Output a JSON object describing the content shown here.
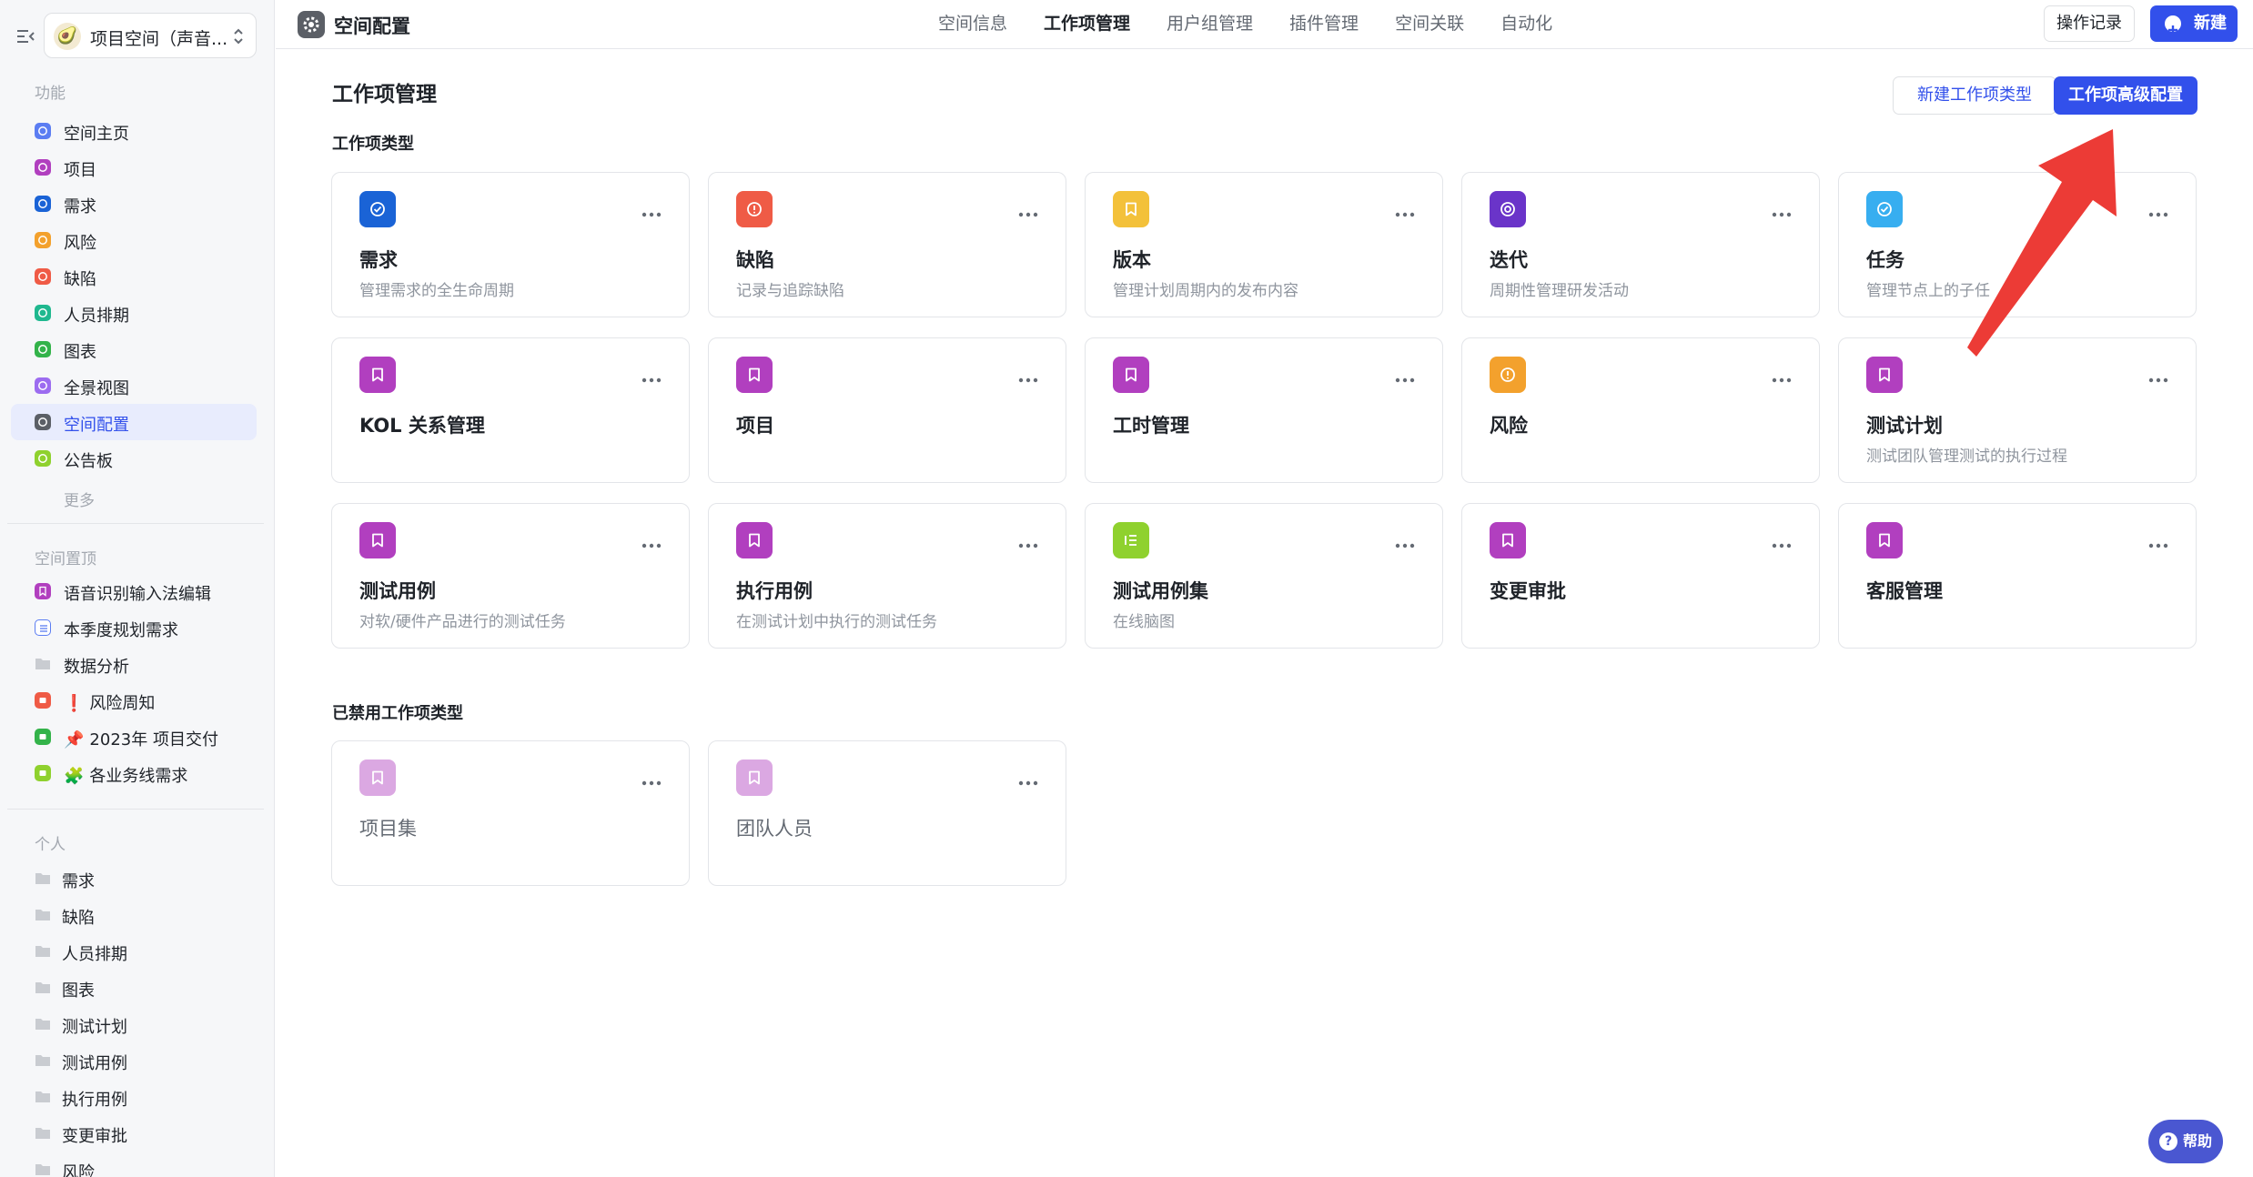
{
  "sidebar": {
    "space_name": "项目空间（声音...",
    "space_avatar": "🥑",
    "sections": {
      "functions_title": "功能",
      "pinned_title": "空间置顶",
      "personal_title": "个人"
    },
    "function_items": [
      {
        "label": "空间主页",
        "color": "#5b7df2"
      },
      {
        "label": "项目",
        "color": "#b13fbf"
      },
      {
        "label": "需求",
        "color": "#1a63d6"
      },
      {
        "label": "风险",
        "color": "#f3a12d"
      },
      {
        "label": "缺陷",
        "color": "#ef5b46"
      },
      {
        "label": "人员排期",
        "color": "#1fb88f"
      },
      {
        "label": "图表",
        "color": "#33b34a"
      },
      {
        "label": "全景视图",
        "color": "#9c6cf0"
      },
      {
        "label": "空间配置",
        "color": "#5b5f66",
        "active": true
      },
      {
        "label": "公告板",
        "color": "#8fd12e"
      }
    ],
    "more_label": "更多",
    "pinned_items": [
      {
        "label": "语音识别输入法编辑",
        "icon": "bookmark-icon",
        "color": "#b13fbf"
      },
      {
        "label": "本季度规划需求",
        "icon": "doc-list-icon",
        "color": "#5b7df2"
      },
      {
        "label": "数据分析",
        "icon": "folder-icon",
        "color": "#c9ccd1"
      },
      {
        "label": "风险周知",
        "prefix": "❗",
        "icon": "red-square-icon",
        "color": "#ef5b46"
      },
      {
        "label": "2023年 项目交付",
        "prefix": "📌",
        "icon": "green-square-icon",
        "color": "#33b34a"
      },
      {
        "label": "各业务线需求",
        "prefix": "🧩",
        "icon": "lime-square-icon",
        "color": "#8fd12e"
      }
    ],
    "personal_items": [
      "需求",
      "缺陷",
      "人员排期",
      "图表",
      "测试计划",
      "测试用例",
      "执行用例",
      "变更审批",
      "风险"
    ]
  },
  "topbar": {
    "title": "空间配置",
    "tabs": [
      "空间信息",
      "工作项管理",
      "用户组管理",
      "插件管理",
      "空间关联",
      "自动化"
    ],
    "active_tab": "工作项管理",
    "log_button": "操作记录",
    "new_button": "新建"
  },
  "main": {
    "title": "工作项管理",
    "new_type_button": "新建工作项类型",
    "advanced_button": "工作项高级配置",
    "types_label": "工作项类型",
    "disabled_label": "已禁用工作项类型",
    "types": [
      {
        "name": "需求",
        "desc": "管理需求的全生命周期",
        "color": "#1a63d6",
        "icon": "check-circle-icon"
      },
      {
        "name": "缺陷",
        "desc": "记录与追踪缺陷",
        "color": "#ef5b46",
        "icon": "alert-circle-icon"
      },
      {
        "name": "版本",
        "desc": "管理计划周期内的发布内容",
        "color": "#f3c13a",
        "icon": "bookmark-icon"
      },
      {
        "name": "迭代",
        "desc": "周期性管理研发活动",
        "color": "#6a34c9",
        "icon": "cycle-icon"
      },
      {
        "name": "任务",
        "desc": "管理节点上的子任",
        "color": "#37aef0",
        "icon": "check-circle-icon"
      },
      {
        "name": "KOL 关系管理",
        "desc": "",
        "color": "#b13fbf",
        "icon": "bookmark-icon"
      },
      {
        "name": "项目",
        "desc": "",
        "color": "#b13fbf",
        "icon": "bookmark-icon"
      },
      {
        "name": "工时管理",
        "desc": "",
        "color": "#b13fbf",
        "icon": "bookmark-icon"
      },
      {
        "name": "风险",
        "desc": "",
        "color": "#f3a12d",
        "icon": "alert-circle-icon"
      },
      {
        "name": "测试计划",
        "desc": "测试团队管理测试的执行过程",
        "color": "#b13fbf",
        "icon": "bookmark-icon"
      },
      {
        "name": "测试用例",
        "desc": "对软/硬件产品进行的测试任务",
        "color": "#b13fbf",
        "icon": "bookmark-icon"
      },
      {
        "name": "执行用例",
        "desc": "在测试计划中执行的测试任务",
        "color": "#b13fbf",
        "icon": "bookmark-icon"
      },
      {
        "name": "测试用例集",
        "desc": "在线脑图",
        "color": "#8fd12e",
        "icon": "list-icon"
      },
      {
        "name": "变更审批",
        "desc": "",
        "color": "#b13fbf",
        "icon": "bookmark-icon"
      },
      {
        "name": "客服管理",
        "desc": "",
        "color": "#b13fbf",
        "icon": "bookmark-icon"
      }
    ],
    "disabled_types": [
      {
        "name": "项目集",
        "color": "#b13fbf",
        "icon": "bookmark-icon"
      },
      {
        "name": "团队人员",
        "color": "#b13fbf",
        "icon": "bookmark-icon"
      }
    ]
  },
  "help_button": "帮助",
  "help_icon": "?"
}
